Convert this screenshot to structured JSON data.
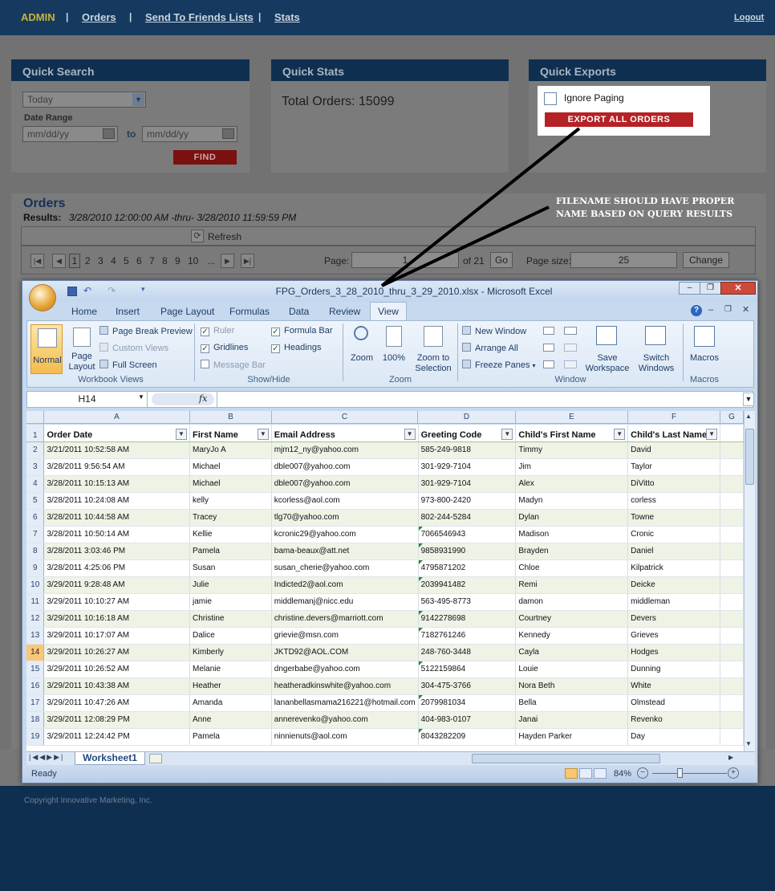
{
  "site": {
    "nav": {
      "admin": "ADMIN",
      "orders": "Orders",
      "send_to_friends": "Send To Friends Lists",
      "stats": "Stats",
      "logout": "Logout"
    },
    "footer": "Copyright Innovative Marketing, Inc."
  },
  "quick_search": {
    "title": "Quick Search",
    "range_select": "Today",
    "date_range_label": "Date Range",
    "from_placeholder": "mm/dd/yy",
    "to_label": "to",
    "to_placeholder": "mm/dd/yy",
    "find_label": "FIND"
  },
  "quick_stats": {
    "title": "Quick Stats",
    "total_orders": "Total Orders: 15099"
  },
  "quick_exports": {
    "title": "Quick Exports",
    "ignore_paging_label": "Ignore Paging",
    "export_label": "EXPORT ALL ORDERS"
  },
  "annotation": {
    "line1": "FILENAME SHOULD HAVE PROPER",
    "line2": "NAME BASED ON QUERY RESULTS"
  },
  "orders": {
    "title": "Orders",
    "results_label": "Results:",
    "results_range": "3/28/2010 12:00:00 AM -thru- 3/28/2010 11:59:59 PM",
    "refresh_label": "Refresh",
    "pages": [
      "1",
      "2",
      "3",
      "4",
      "5",
      "6",
      "7",
      "8",
      "9",
      "10",
      "..."
    ],
    "page_label": "Page:",
    "page_value": "1",
    "of_pages": "of 21",
    "go_label": "Go",
    "page_size_label": "Page size:",
    "page_size_value": "25",
    "change_label": "Change"
  },
  "excel": {
    "window_title": "FPG_Orders_3_28_2010_thru_3_29_2010.xlsx - Microsoft Excel",
    "tabs": [
      "Home",
      "Insert",
      "Page Layout",
      "Formulas",
      "Data",
      "Review",
      "View"
    ],
    "active_tab": "View",
    "workbook_views": {
      "label": "Workbook Views",
      "normal": "Normal",
      "page_layout_1": "Page",
      "page_layout_2": "Layout",
      "page_break": "Page Break Preview",
      "custom_views": "Custom Views",
      "full_screen": "Full Screen"
    },
    "show_hide": {
      "label": "Show/Hide",
      "ruler": "Ruler",
      "formula_bar": "Formula Bar",
      "gridlines": "Gridlines",
      "headings": "Headings",
      "message_bar": "Message Bar"
    },
    "zoom": {
      "label": "Zoom",
      "zoom": "Zoom",
      "hundred": "100%",
      "zoom_sel_1": "Zoom to",
      "zoom_sel_2": "Selection"
    },
    "window": {
      "label": "Window",
      "new_window": "New Window",
      "arrange_all": "Arrange All",
      "freeze_panes": "Freeze Panes",
      "save_ws_1": "Save",
      "save_ws_2": "Workspace",
      "switch_1": "Switch",
      "switch_2": "Windows"
    },
    "macros": {
      "label": "Macros",
      "macros": "Macros"
    },
    "name_box": "H14",
    "fx": "fx",
    "col_letters": [
      "A",
      "B",
      "C",
      "D",
      "E",
      "F",
      "G"
    ],
    "headers": [
      "Order Date",
      "First Name",
      "Email Address",
      "Greeting Code",
      "Child's First Name",
      "Child's Last Name"
    ],
    "rows": [
      [
        "3/21/2011 10:52:58 AM",
        "MaryJo A",
        "mjm12_ny@yahoo.com",
        "585-249-9818",
        "Timmy",
        "David"
      ],
      [
        "3/28/2011 9:56:54 AM",
        "Michael",
        "dble007@yahoo.com",
        "301-929-7104",
        "Jim",
        "Taylor"
      ],
      [
        "3/28/2011 10:15:13 AM",
        "Michael",
        "dble007@yahoo.com",
        "301-929-7104",
        "Alex",
        "DiVitto"
      ],
      [
        "3/28/2011 10:24:08 AM",
        "kelly",
        "kcorless@aol.com",
        "973-800-2420",
        "Madyn",
        "corless"
      ],
      [
        "3/28/2011 10:44:58 AM",
        "Tracey",
        "tlg70@yahoo.com",
        "802-244-5284",
        "Dylan",
        "Towne"
      ],
      [
        "3/28/2011 10:50:14 AM",
        "Kellie",
        "kcronic29@yahoo.com",
        "7066546943",
        "Madison",
        "Cronic"
      ],
      [
        "3/28/2011 3:03:46 PM",
        "Pamela",
        "bama-beaux@att.net",
        "9858931990",
        "Brayden",
        "Daniel"
      ],
      [
        "3/28/2011 4:25:06 PM",
        "Susan",
        "susan_cherie@yahoo.com",
        "4795871202",
        "Chloe",
        "Kilpatrick"
      ],
      [
        "3/29/2011 9:28:48 AM",
        "Julie",
        "Indicted2@aol.com",
        "2039941482",
        "Remi",
        "Deicke"
      ],
      [
        "3/29/2011 10:10:27 AM",
        "jamie",
        "middlemanj@nicc.edu",
        "563-495-8773",
        "damon",
        "middleman"
      ],
      [
        "3/29/2011 10:16:18 AM",
        "Christine",
        "christine.devers@marriott.com",
        "9142278698",
        "Courtney",
        "Devers"
      ],
      [
        "3/29/2011 10:17:07 AM",
        "Dalice",
        "grievie@msn.com",
        "7182761246",
        "Kennedy",
        "Grieves"
      ],
      [
        "3/29/2011 10:26:27 AM",
        "Kimberly",
        "JKTD92@AOL.COM",
        "248-760-3448",
        "Cayla",
        "Hodges"
      ],
      [
        "3/29/2011 10:26:52 AM",
        "Melanie",
        "dngerbabe@yahoo.com",
        "5122159864",
        "Louie",
        "Dunning"
      ],
      [
        "3/29/2011 10:43:38 AM",
        "Heather",
        "heatheradkinswhite@yahoo.com",
        "304-475-3766",
        "Nora Beth",
        "White"
      ],
      [
        "3/29/2011 10:47:26 AM",
        "Amanda",
        "lananbellasmama216221@hotmail.com",
        "2079981034",
        "Bella",
        "Olmstead"
      ],
      [
        "3/29/2011 12:08:29 PM",
        "Anne",
        "annerevenko@yahoo.com",
        "404-983-0107",
        "Janai",
        "Revenko"
      ],
      [
        "3/29/2011 12:24:42 PM",
        "Pamela",
        "ninnienuts@aol.com",
        "8043282209",
        "Hayden Parker",
        "Day"
      ]
    ],
    "sheet_tab": "Worksheet1",
    "status": "Ready",
    "zoom_level": "84%"
  }
}
